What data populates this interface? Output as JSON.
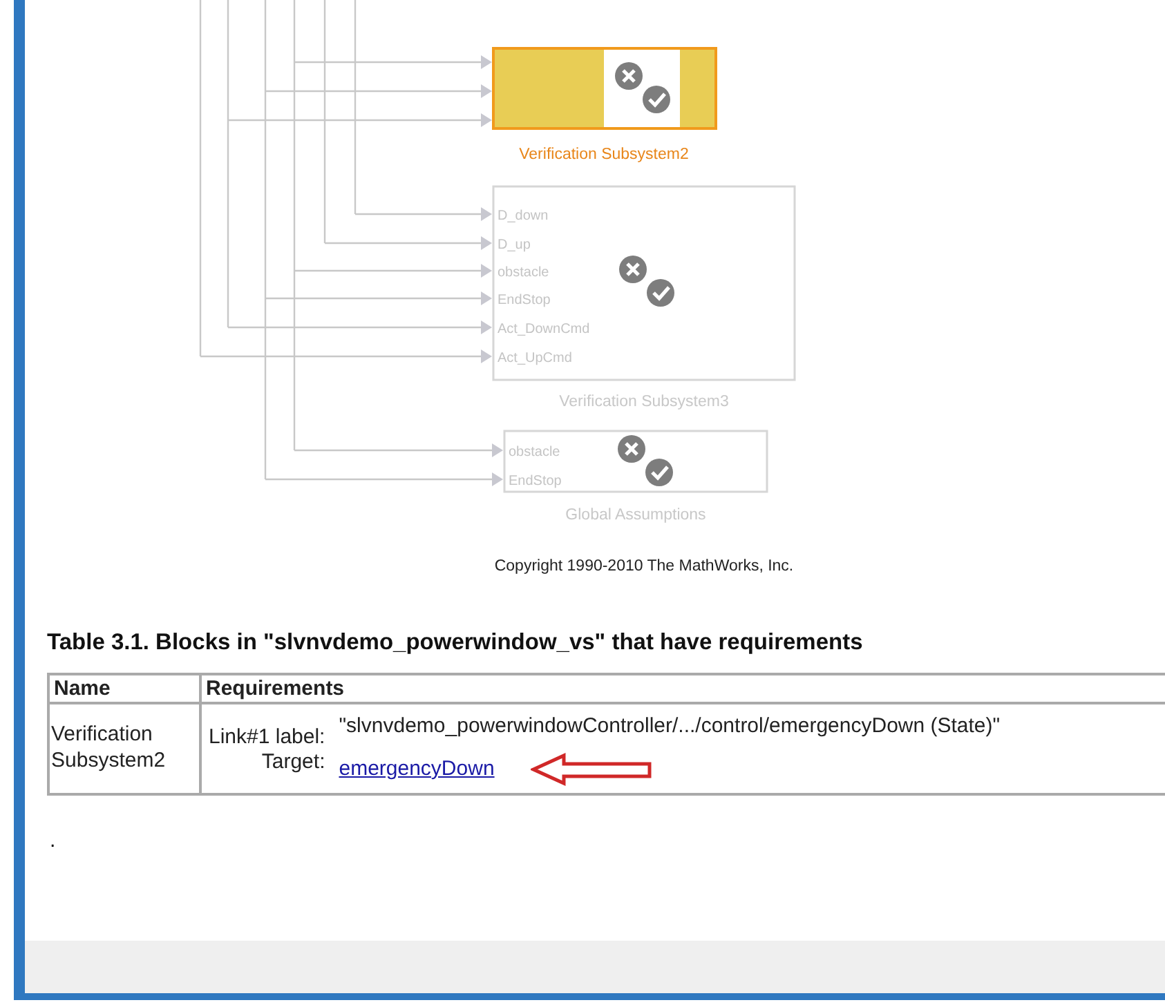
{
  "diagram": {
    "blocks": [
      {
        "label": "Verification Subsystem2",
        "selected": true
      },
      {
        "label": "Verification Subsystem3",
        "selected": false,
        "ports": [
          "D_down",
          "D_up",
          "obstacle",
          "EndStop",
          "Act_DownCmd",
          "Act_UpCmd"
        ]
      },
      {
        "label": "Global Assumptions",
        "selected": false,
        "ports": [
          "obstacle",
          "EndStop"
        ]
      }
    ],
    "copyright": "Copyright 1990-2010 The MathWorks, Inc."
  },
  "table": {
    "caption": "Table 3.1. Blocks in \"slvnvdemo_powerwindow_vs\" that have requirements",
    "columns": [
      "Name",
      "Requirements"
    ],
    "rows": [
      {
        "name": "Verification Subsystem2",
        "link_key": "Link#1 label:",
        "link_label": "\"slvnvdemo_powerwindowController/.../control/emergencyDown (State)\"",
        "target_key": "Target:",
        "target": "emergencyDown"
      }
    ]
  },
  "footer_text": "."
}
